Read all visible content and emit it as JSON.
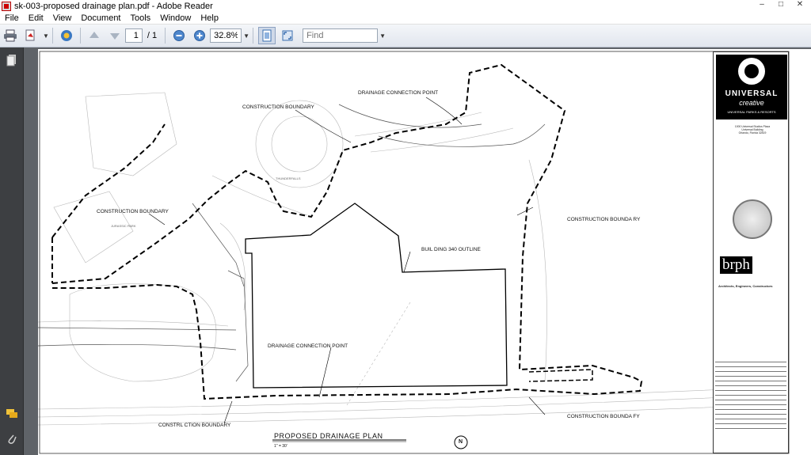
{
  "window": {
    "title": "sk-003-proposed drainage plan.pdf - Adobe Reader",
    "controls": [
      "–",
      "□",
      "✕"
    ]
  },
  "menu": [
    "File",
    "Edit",
    "View",
    "Document",
    "Tools",
    "Window",
    "Help"
  ],
  "toolbar": {
    "page_current": "1",
    "page_total": "/ 1",
    "zoom": "32.8%",
    "find_placeholder": "Find"
  },
  "drawing": {
    "labels": {
      "construction_boundary_top": "CONSTRUCTION BOUNDARY",
      "drainage_connection_top": "DRAINAGE CONNECTION POINT",
      "construction_boundary_left": "CONSTRUCTION BOUNDARY",
      "construction_boundary_right": "CONSTRUCTION BOUNDA RY",
      "building_outline": "BUIL DING 340 OUTLINE",
      "drainage_connection_mid": "DRAINAGE CONNECTION POINT",
      "construction_boundary_bottom_left": "CONSTRL CTION BOUNDARY",
      "construction_boundary_bottom_right": "CONSTRUCTION BOUNDA FY",
      "plan_title": "PROPOSED DRAINAGE PLAN",
      "scale": "1\" = 30'",
      "north": "N",
      "thunderfalls": "THUNDERFALLS",
      "jurassic_park": "JURASSIC PARK"
    }
  },
  "titleblock": {
    "brand_line1": "UNIVERSAL",
    "brand_line2": "creative",
    "brand_line3": "UNIVERSAL PARKS & RESORTS",
    "address": "1000 Universal Studios Plaza\nUniversal Building\nOrlando, Florida 32819",
    "architect_logo": "brph",
    "architect_tag": "Architects, Engineers, Constructors"
  }
}
